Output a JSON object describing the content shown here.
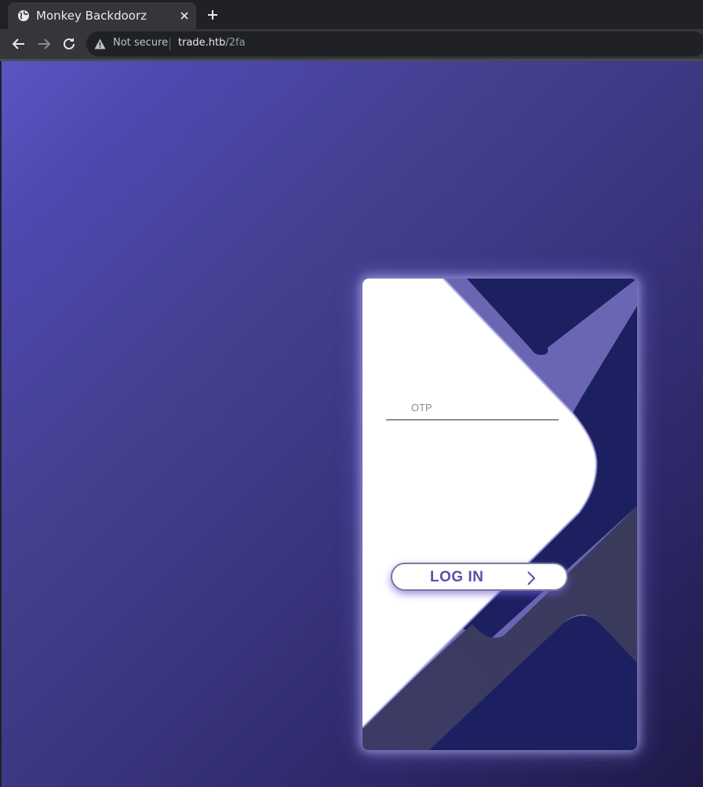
{
  "browser": {
    "tab_title": "Monkey Backdoorz",
    "security_label": "Not secure",
    "url_host": "trade.htb",
    "url_path": "/2fa"
  },
  "login_form": {
    "otp_placeholder": "OTP",
    "login_button_label": "LOG IN"
  },
  "icons": {
    "tab": "globe-icon",
    "tab_close": "close-icon",
    "new_tab": "plus-icon",
    "back": "back-arrow-icon",
    "forward": "forward-arrow-icon",
    "reload": "reload-icon",
    "security": "warning-icon",
    "submit": "chevron-right-icon"
  },
  "colors": {
    "card_navy": "#1c2060",
    "card_slate": "#3a3a60",
    "accent": "#5a50a8"
  }
}
